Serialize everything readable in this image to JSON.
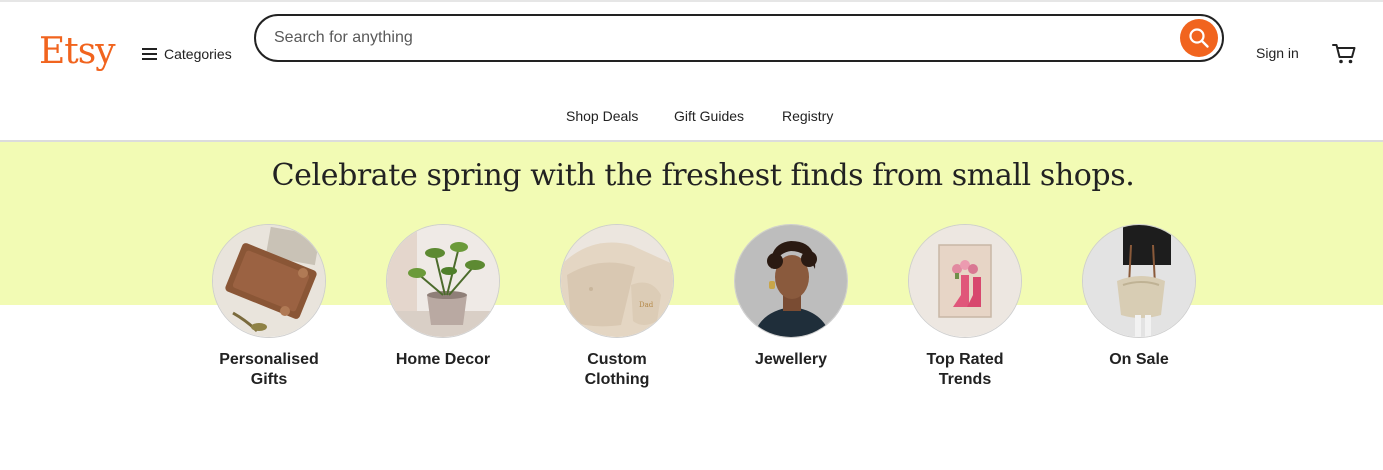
{
  "header": {
    "logo": "Etsy",
    "categories_label": "Categories",
    "search_placeholder": "Search for anything",
    "search_value": "",
    "signin_label": "Sign in"
  },
  "subnav": {
    "items": [
      "Shop Deals",
      "Gift Guides",
      "Registry"
    ]
  },
  "banner": {
    "headline": "Celebrate spring with the freshest finds from small shops.",
    "background": "#f2fbb4"
  },
  "categories": [
    {
      "line1": "Personalised",
      "line2": "Gifts",
      "icon": "leather-card-photo"
    },
    {
      "line1": "Home Decor",
      "line2": "",
      "icon": "potted-plant-photo"
    },
    {
      "line1": "Custom",
      "line2": "Clothing",
      "icon": "sweatshirt-photo"
    },
    {
      "line1": "Jewellery",
      "line2": "",
      "icon": "woman-earrings-photo"
    },
    {
      "line1": "Top Rated",
      "line2": "Trends",
      "icon": "cowboy-boots-print-photo"
    },
    {
      "line1": "On Sale",
      "line2": "",
      "icon": "handbag-photo"
    }
  ],
  "colors": {
    "brand": "#f1641e",
    "text": "#222222",
    "banner": "#f2fbb4"
  }
}
